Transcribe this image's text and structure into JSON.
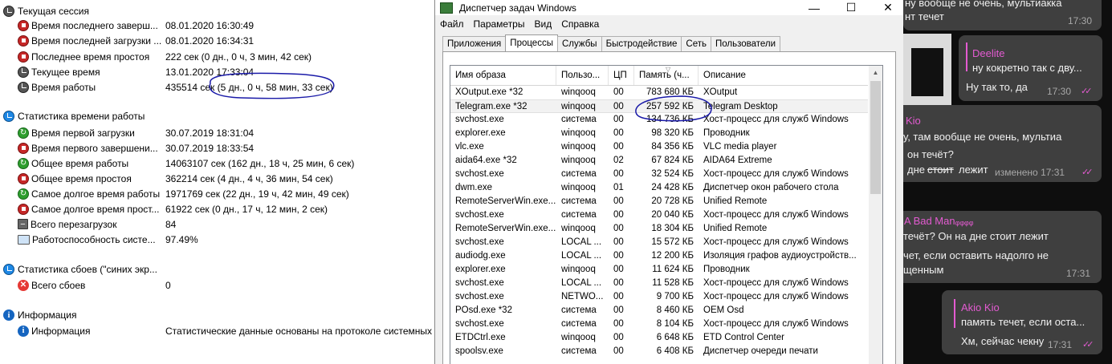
{
  "stats": {
    "current_session": {
      "title": "Текущая сессия",
      "rows": [
        {
          "icon": "stop-icon",
          "label": "Время последнего заверш...",
          "value": "08.01.2020 16:30:49"
        },
        {
          "icon": "stop-icon",
          "label": "Время последней загрузки ...",
          "value": "08.01.2020 16:34:31"
        },
        {
          "icon": "stop-icon",
          "label": "Последнее время простоя",
          "value": "222 сек (0 дн., 0 ч, 3 мин, 42 сек)"
        },
        {
          "icon": "clock-icon",
          "label": "Текущее время",
          "value": "13.01.2020 17:33:04"
        },
        {
          "icon": "clock-icon",
          "label": "Время работы",
          "value": "435514 сек (5 дн., 0 ч, 58 мин, 33 сек)"
        }
      ]
    },
    "uptime_stats": {
      "title": "Статистика времени работы",
      "rows": [
        {
          "icon": "refresh-icon",
          "label": "Время первой загрузки",
          "value": "30.07.2019 18:31:04"
        },
        {
          "icon": "stop-icon",
          "label": "Время первого завершени...",
          "value": "30.07.2019 18:33:54"
        },
        {
          "icon": "refresh-icon",
          "label": "Общее время работы",
          "value": "14063107 сек (162 дн., 18 ч, 25 мин, 6 сек)"
        },
        {
          "icon": "stop-icon",
          "label": "Общее время простоя",
          "value": "362214 сек (4 дн., 4 ч, 36 мин, 54 сек)"
        },
        {
          "icon": "refresh-icon",
          "label": "Самое долгое время работы",
          "value": "1971769 сек (22 дн., 19 ч, 42 мин, 49 сек)"
        },
        {
          "icon": "stop-icon",
          "label": "Самое долгое время прост...",
          "value": "61922 сек (0 дн., 17 ч, 12 мин, 2 сек)"
        },
        {
          "icon": "minus-icon",
          "label": "Всего перезагрузок",
          "value": "84"
        },
        {
          "icon": "monitor-icon",
          "label": "Работоспособность систе...",
          "value": "97.49%"
        }
      ]
    },
    "crash_stats": {
      "title": "Статистика сбоев (\"синих экр...",
      "rows": [
        {
          "icon": "x-icon",
          "label": "Всего сбоев",
          "value": "0"
        }
      ]
    },
    "info": {
      "title": "Информация",
      "rows": [
        {
          "icon": "info-icon",
          "label": "Информация",
          "value": "Статистические данные основаны на протоколе системных"
        }
      ]
    }
  },
  "taskmgr": {
    "title": "Диспетчер задач Windows",
    "window_buttons": {
      "minimize": "—",
      "maximize": "☐",
      "close": "✕"
    },
    "menu": [
      "Файл",
      "Параметры",
      "Вид",
      "Справка"
    ],
    "tabs": [
      "Приложения",
      "Процессы",
      "Службы",
      "Быстродействие",
      "Сеть",
      "Пользователи"
    ],
    "active_tab": "Процессы",
    "columns": [
      "Имя образа",
      "Пользо...",
      "ЦП",
      "Память (ч...",
      "Описание"
    ],
    "processes": [
      [
        "XOutput.exe *32",
        "winqooq",
        "00",
        "783 680 КБ",
        "XOutput"
      ],
      [
        "Telegram.exe *32",
        "winqooq",
        "00",
        "257 592 КБ",
        "Telegram Desktop"
      ],
      [
        "svchost.exe",
        "система",
        "00",
        "134 736 КБ",
        "Хост-процесс для служб Windows"
      ],
      [
        "explorer.exe",
        "winqooq",
        "00",
        "98 320 КБ",
        "Проводник"
      ],
      [
        "vlc.exe",
        "winqooq",
        "00",
        "84 356 КБ",
        "VLC media player"
      ],
      [
        "aida64.exe *32",
        "winqooq",
        "02",
        "67 824 КБ",
        "AIDA64 Extreme"
      ],
      [
        "svchost.exe",
        "система",
        "00",
        "32 524 КБ",
        "Хост-процесс для служб Windows"
      ],
      [
        "dwm.exe",
        "winqooq",
        "01",
        "24 428 КБ",
        "Диспетчер окон рабочего стола"
      ],
      [
        "RemoteServerWin.exe...",
        "система",
        "00",
        "20 728 КБ",
        "Unified Remote"
      ],
      [
        "svchost.exe",
        "система",
        "00",
        "20 040 КБ",
        "Хост-процесс для служб Windows"
      ],
      [
        "RemoteServerWin.exe...",
        "winqooq",
        "00",
        "18 304 КБ",
        "Unified Remote"
      ],
      [
        "svchost.exe",
        "LOCAL ...",
        "00",
        "15 572 КБ",
        "Хост-процесс для служб Windows"
      ],
      [
        "audiodg.exe",
        "LOCAL ...",
        "00",
        "12 200 КБ",
        "Изоляция графов аудиоустройств..."
      ],
      [
        "explorer.exe",
        "winqooq",
        "00",
        "11 624 КБ",
        "Проводник"
      ],
      [
        "svchost.exe",
        "LOCAL ...",
        "00",
        "11 528 КБ",
        "Хост-процесс для служб Windows"
      ],
      [
        "svchost.exe",
        "NETWO...",
        "00",
        "9 700 КБ",
        "Хост-процесс для служб Windows"
      ],
      [
        "POsd.exe *32",
        "система",
        "00",
        "8 460 КБ",
        "OEM Osd"
      ],
      [
        "svchost.exe",
        "система",
        "00",
        "8 104 КБ",
        "Хост-процесс для служб Windows"
      ],
      [
        "ETDCtrl.exe",
        "winqooq",
        "00",
        "6 648 КБ",
        "ETD Control Center"
      ],
      [
        "spoolsv.exe",
        "система",
        "00",
        "6 408 КБ",
        "Диспетчер очереди печати"
      ]
    ]
  },
  "chat": {
    "messages": [
      {
        "author": "",
        "lines": [
          "ну вообще не очень, мультиакка",
          "нт течет"
        ],
        "time": "17:30",
        "checks": ""
      },
      {
        "author": "Deelite",
        "lines": [
          "ну кокретно так с дву...",
          "Ну так то, да"
        ],
        "time": "17:30",
        "checks": "✓✓"
      },
      {
        "author": "Kio",
        "lines": [
          "у, там вообще не очень, мультиа",
          "он течёт?",
          "дне",
          "стоит",
          "лежит"
        ],
        "time": "изменено 17:31",
        "checks": "✓✓"
      },
      {
        "author": "A Bad Manᵩᵩᵩᵩ",
        "lines": [
          "течёт? Он на дне стоит лежит",
          "чет, если оставить надолго не",
          "щенным"
        ],
        "time": "17:31",
        "checks": ""
      },
      {
        "author": "Akio Kio",
        "lines": [
          "память течет, если оста...",
          "Хм, сейчас чекну"
        ],
        "time": "17:31",
        "checks": "✓✓"
      }
    ]
  },
  "colors": {
    "accent_pink": "#e35bd1",
    "annotation_blue": "#1a1aa8",
    "chat_bg": "#0e0e0e",
    "bubble_bg": "#3f3f3f"
  }
}
